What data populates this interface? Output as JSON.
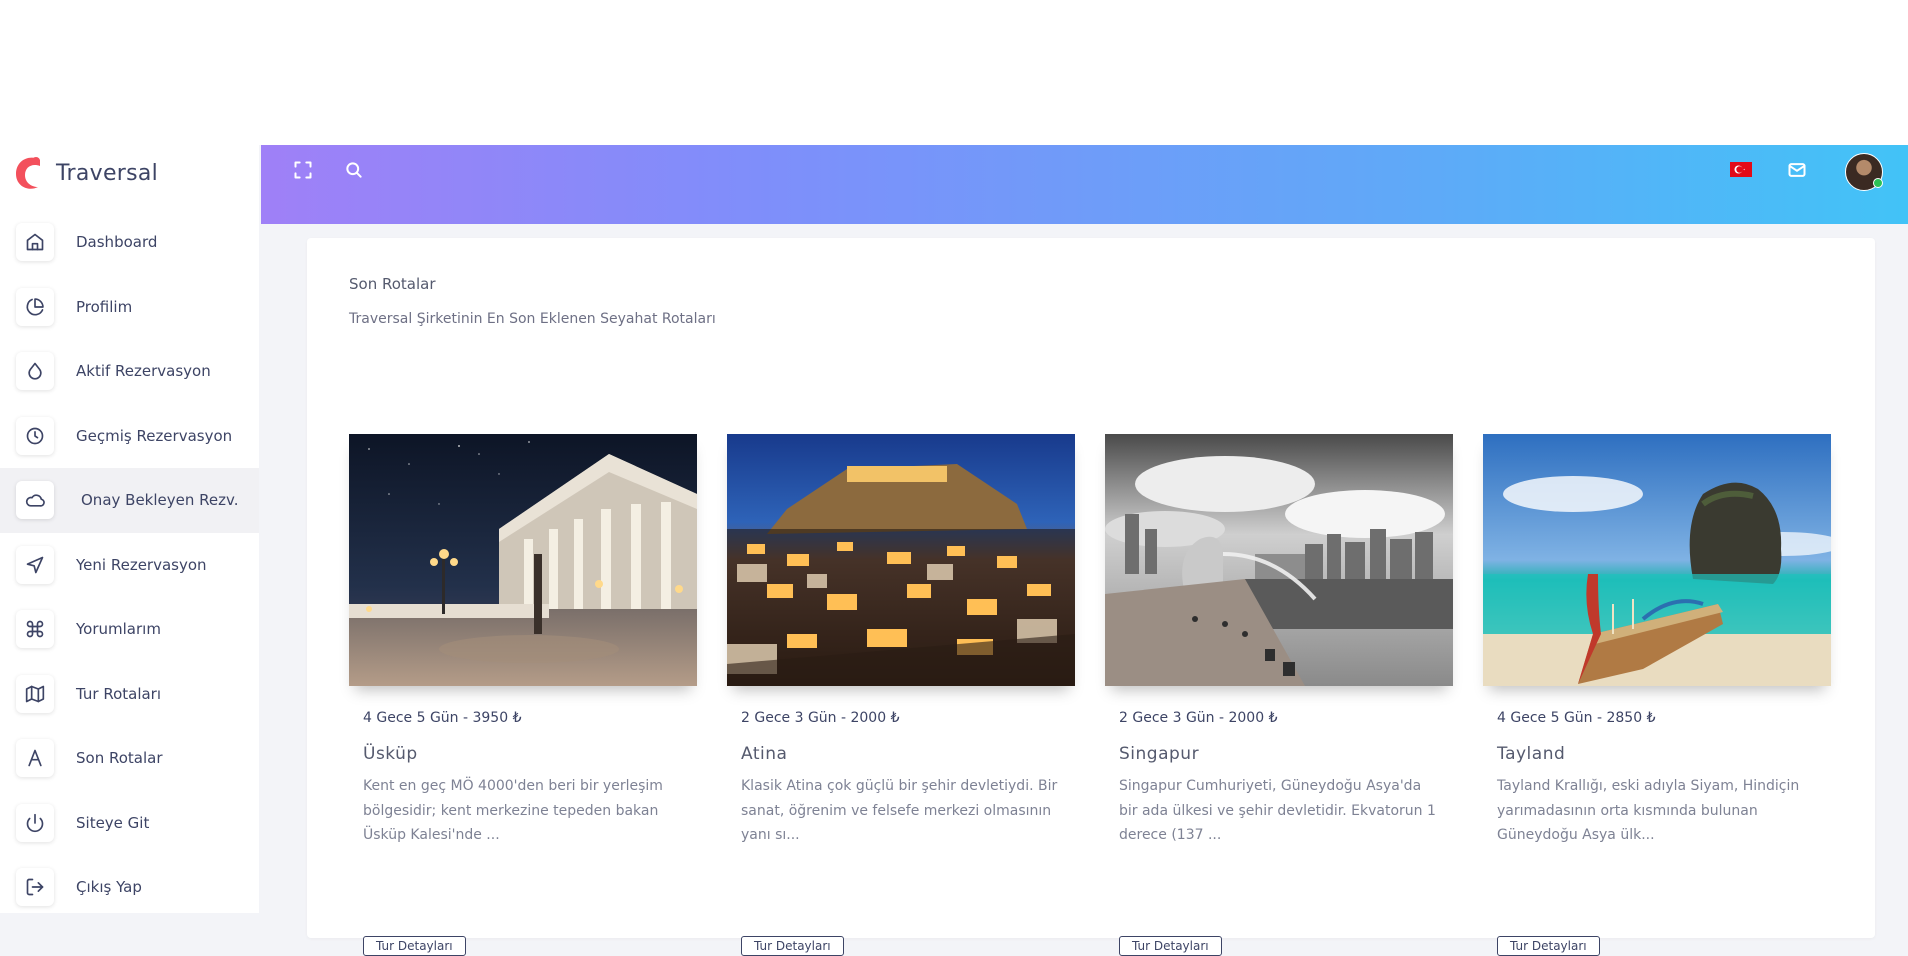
{
  "app": {
    "name": "Traversal"
  },
  "sidebar": {
    "items": [
      {
        "label": "Dashboard",
        "icon": "home-icon"
      },
      {
        "label": "Profilim",
        "icon": "pie-chart-icon"
      },
      {
        "label": "Aktif Rezervasyon",
        "icon": "droplet-icon"
      },
      {
        "label": "Geçmiş Rezervasyon",
        "icon": "clock-icon"
      },
      {
        "label": "Onay Bekleyen Rezv.",
        "icon": "cloud-icon",
        "active": true
      },
      {
        "label": "Yeni Rezervasyon",
        "icon": "navigation-icon"
      },
      {
        "label": "Yorumlarım",
        "icon": "command-icon"
      },
      {
        "label": "Tur Rotaları",
        "icon": "map-icon"
      },
      {
        "label": "Son Rotalar",
        "icon": "triangle-a-icon"
      },
      {
        "label": "Siteye Git",
        "icon": "power-icon"
      },
      {
        "label": "Çıkış Yap",
        "icon": "logout-icon"
      }
    ]
  },
  "header": {
    "icons": [
      "fullscreen-icon",
      "search-icon",
      "turkey-flag-icon",
      "mail-icon",
      "avatar"
    ],
    "gradient": [
      "#9f80f7",
      "#42c3f7"
    ]
  },
  "main": {
    "title": "Son Rotalar",
    "subtitle": "Traversal Şirketinin En Son Eklenen Seyahat Rotaları",
    "tours": [
      {
        "meta": "4 Gece 5 Gün - 3950 ₺",
        "name": "Üsküp",
        "description": "Kent en geç MÖ 4000'den beri bir yerleşim bölgesidir; kent merkezine tepeden bakan Üsküp Kalesi'nde ...",
        "button": "Tur Detayları"
      },
      {
        "meta": "2 Gece 3 Gün - 2000 ₺",
        "name": "Atina",
        "description": "Klasik Atina çok güçlü bir şehir devletiydi. Bir sanat, öğrenim ve felsefe merkezi olmasının yanı sı...",
        "button": "Tur Detayları"
      },
      {
        "meta": "2 Gece 3 Gün - 2000 ₺",
        "name": "Singapur",
        "description": "Singapur Cumhuriyeti, Güneydoğu Asya'da bir ada ülkesi ve şehir devletidir. Ekvatorun 1 derece (137 ...",
        "button": "Tur Detayları"
      },
      {
        "meta": "4 Gece 5 Gün - 2850 ₺",
        "name": "Tayland",
        "description": "Tayland Krallığı, eski adıyla Siyam, Hindiçin yarımadasının orta kısmında bulunan Güneydoğu Asya ülk...",
        "button": "Tur Detayları"
      }
    ]
  }
}
